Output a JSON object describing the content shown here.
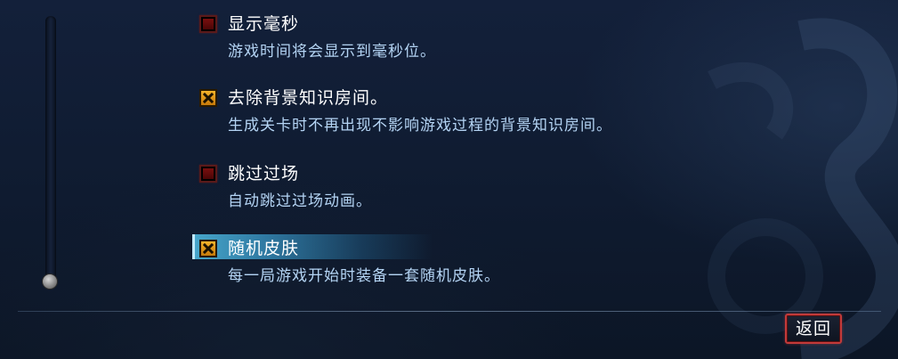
{
  "options": [
    {
      "title": "显示毫秒",
      "description": "游戏时间将会显示到毫秒位。",
      "checked": false,
      "selected": false
    },
    {
      "title": "去除背景知识房间。",
      "description": "生成关卡时不再出现不影响游戏过程的背景知识房间。",
      "checked": true,
      "selected": false
    },
    {
      "title": "跳过过场",
      "description": "自动跳过过场动画。",
      "checked": false,
      "selected": false
    },
    {
      "title": "随机皮肤",
      "description": "每一局游戏开始时装备一套随机皮肤。",
      "checked": true,
      "selected": true
    }
  ],
  "footer": {
    "back_label": "返回"
  },
  "colors": {
    "checkbox_on": "#f4b22a",
    "checkbox_off": "#5a0a0a",
    "selection_highlight": "#50bee6",
    "description_text": "#b4d4f4",
    "back_border": "#c23a3a"
  },
  "icons": {
    "checked": "x-check-icon",
    "unchecked": "empty-checkbox-icon"
  }
}
